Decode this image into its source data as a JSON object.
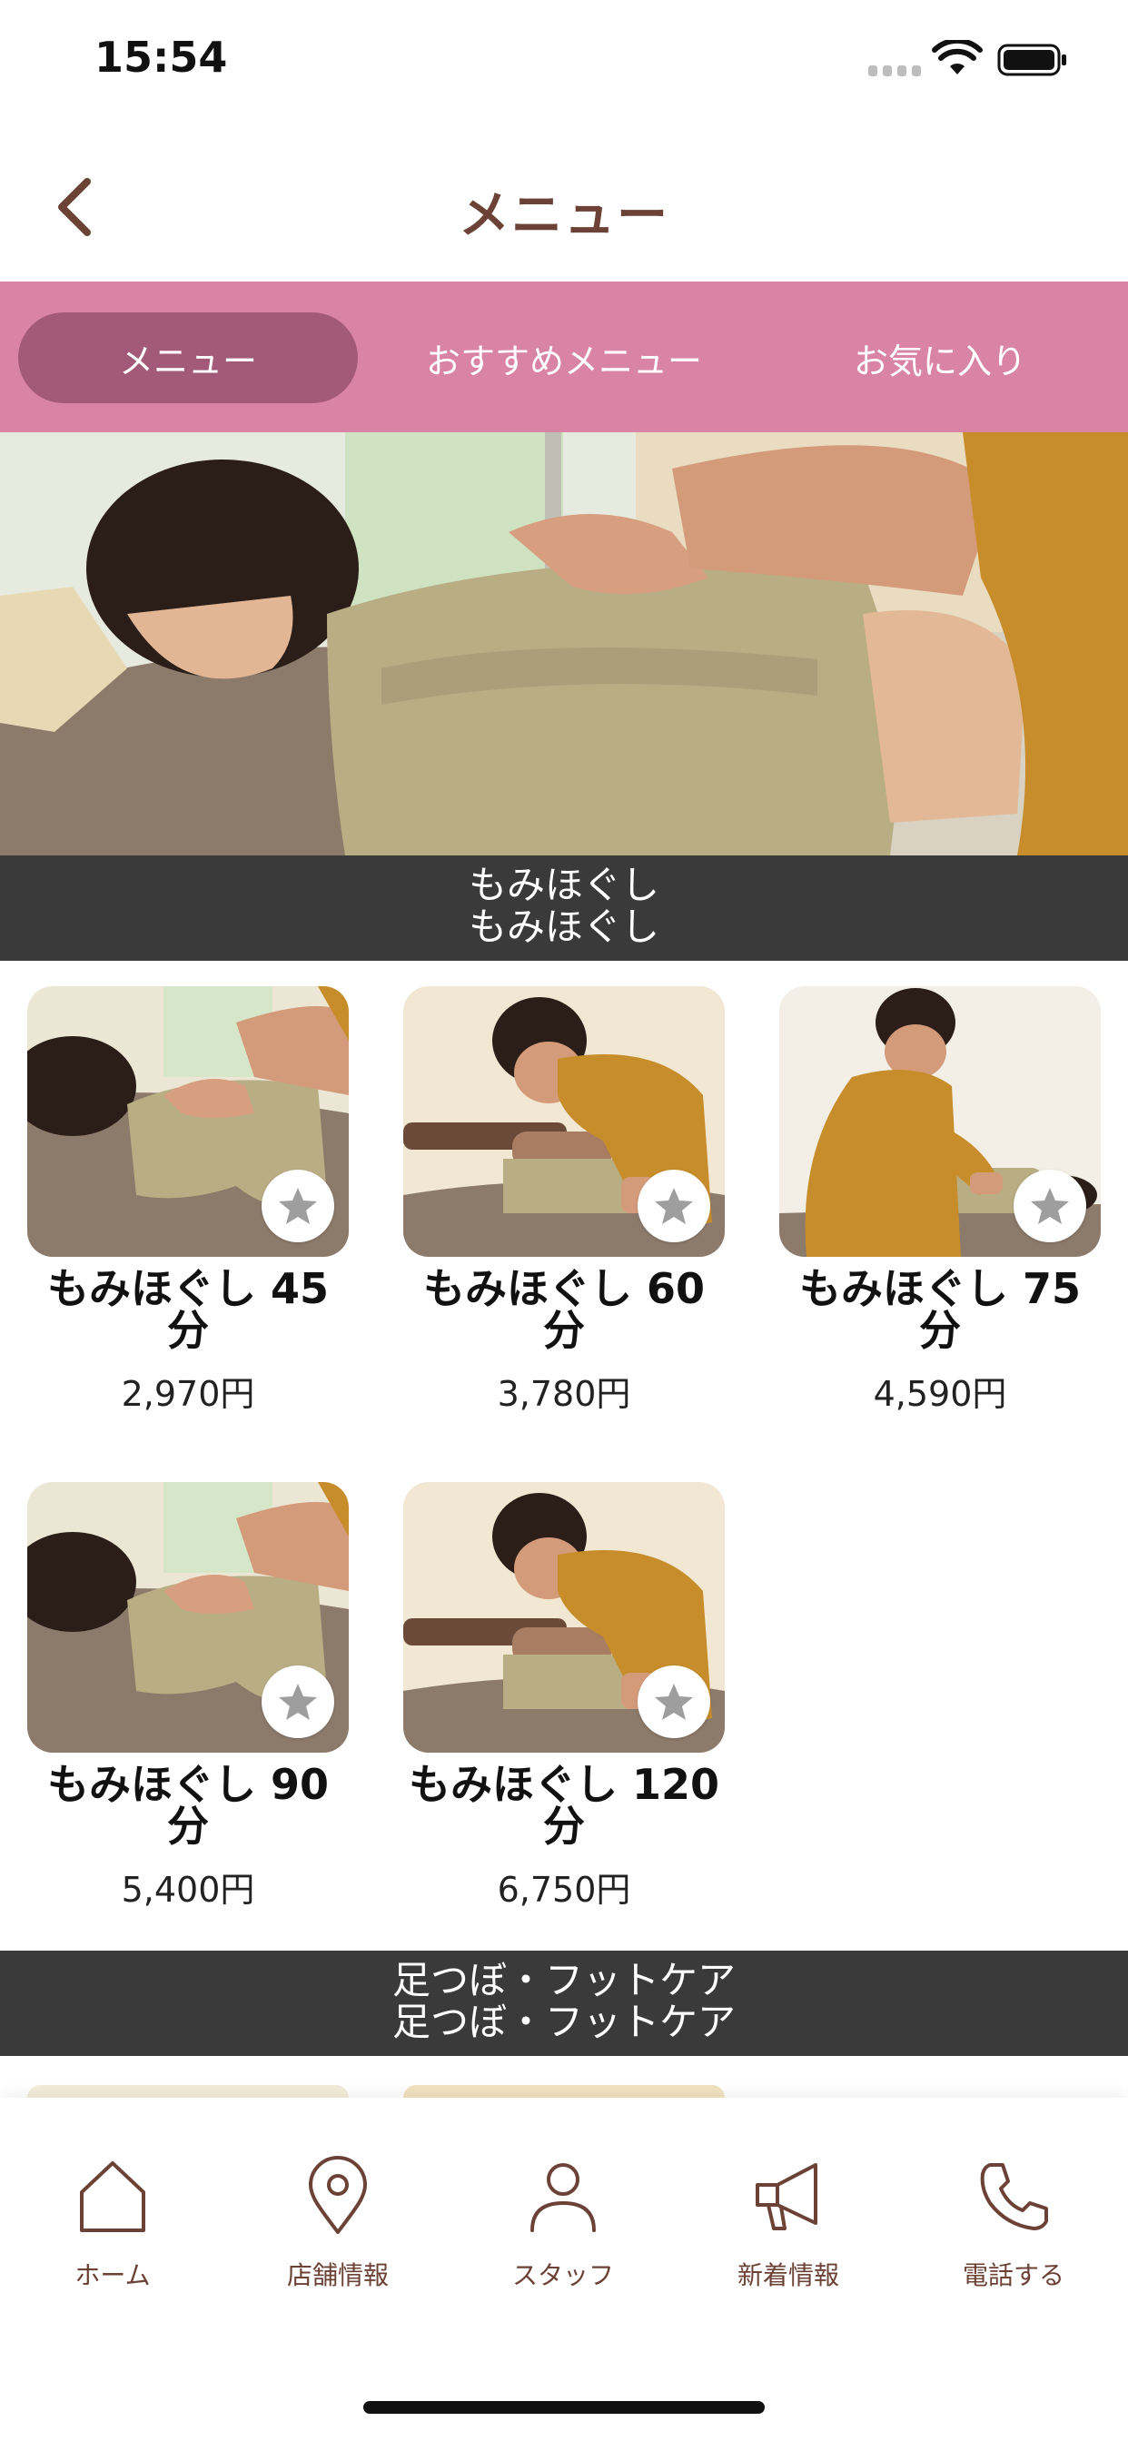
{
  "status": {
    "time": "15:54"
  },
  "nav": {
    "title": "メニュー"
  },
  "tabs": [
    {
      "label": "メニュー",
      "active": true
    },
    {
      "label": "おすすめメニュー",
      "active": false
    },
    {
      "label": "お気に入り",
      "active": false
    }
  ],
  "sections": [
    {
      "title": "もみほぐし",
      "subtitle": "もみほぐし",
      "items": [
        {
          "name_line1": "もみほぐし 45",
          "name_line2": "分",
          "price": "2,970円"
        },
        {
          "name_line1": "もみほぐし 60",
          "name_line2": "分",
          "price": "3,780円"
        },
        {
          "name_line1": "もみほぐし 75",
          "name_line2": "分",
          "price": "4,590円"
        },
        {
          "name_line1": "もみほぐし 90",
          "name_line2": "分",
          "price": "5,400円"
        },
        {
          "name_line1": "もみほぐし 120",
          "name_line2": "分",
          "price": "6,750円"
        }
      ]
    },
    {
      "title": "足つぼ・フットケア",
      "subtitle": "足つぼ・フットケア",
      "items": []
    }
  ],
  "footer": [
    {
      "label": "ホーム",
      "icon": "home-icon"
    },
    {
      "label": "店舗情報",
      "icon": "location-pin-icon"
    },
    {
      "label": "スタッフ",
      "icon": "person-icon"
    },
    {
      "label": "新着情報",
      "icon": "megaphone-icon"
    },
    {
      "label": "電話する",
      "icon": "phone-icon"
    }
  ],
  "colors": {
    "accent": "#d984a4",
    "accent_active": "#a35a79",
    "brand_brown": "#6b4235",
    "section_bg": "#3a3a3a"
  }
}
